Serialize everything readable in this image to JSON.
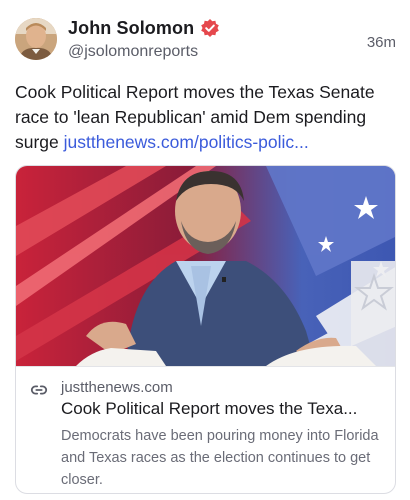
{
  "post": {
    "author_name": "John Solomon",
    "author_handle": "@jsolomonreports",
    "timestamp": "36m",
    "text": "Cook Political Report moves the Texas Senate race to 'lean Republican' amid Dem spending surge ",
    "link_text": "justthenews.com/politics-polic..."
  },
  "card": {
    "domain": "justthenews.com",
    "title": "Cook Political Report moves the Texa...",
    "description": "Democrats have been pouring money into Florida and Texas races as the election continues to get closer."
  },
  "colors": {
    "link": "#3b5bdb",
    "verified": "#e5484d",
    "text": "#1b1b1f",
    "muted": "#5b5d68"
  },
  "icons": {
    "verified": "verified-badge-icon",
    "link": "link-icon"
  }
}
